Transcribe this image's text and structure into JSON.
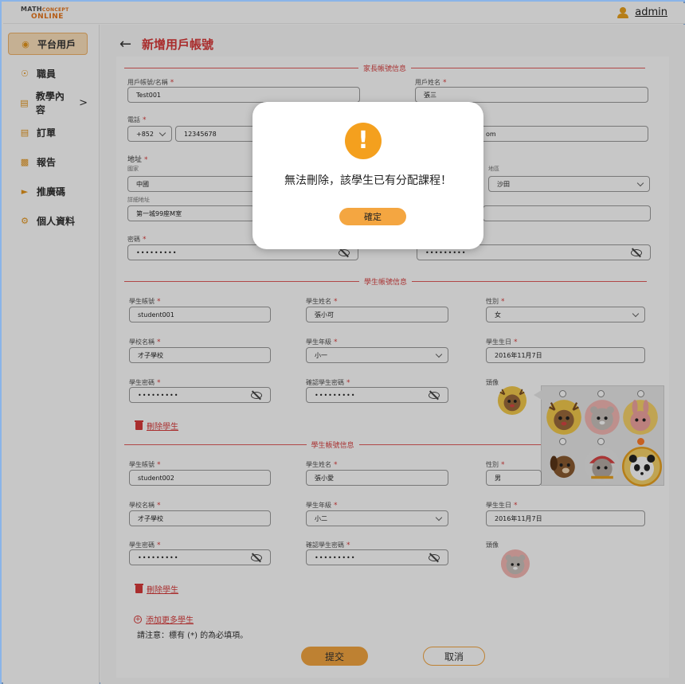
{
  "app": {
    "logo_line1": "MATH",
    "logo_line1b": "CONCEPT",
    "logo_line2": "ONLINE",
    "user": "admin"
  },
  "sidebar": {
    "items": [
      {
        "label": "平台用戶",
        "icon": "users-icon"
      },
      {
        "label": "職員",
        "icon": "staff-icon"
      },
      {
        "label": "教學內容",
        "icon": "book-icon",
        "chevron": ">"
      },
      {
        "label": "訂單",
        "icon": "order-icon"
      },
      {
        "label": "報告",
        "icon": "report-icon"
      },
      {
        "label": "推廣碼",
        "icon": "megaphone-icon"
      },
      {
        "label": "個人資料",
        "icon": "profile-icon"
      }
    ]
  },
  "page": {
    "back": "←",
    "title": "新增用戶帳號"
  },
  "parent": {
    "section_title": "家長帳號信息",
    "account_label": "用戶帳號/名稱",
    "account_value": "Test001",
    "name_label": "用戶姓名",
    "name_value": "張三",
    "phone_label": "電話",
    "phone_code": "+852",
    "phone_value": "12345678",
    "email_value": "om",
    "address_label": "地址",
    "country_label": "國家",
    "country_value": "中國",
    "district_label": "地區",
    "district_value": "沙田",
    "detail_label": "詳細地址",
    "detail_value": "第一城99座M室",
    "password_label": "密碼",
    "password_value": "•••••••••",
    "confirm_value": "•••••••••"
  },
  "students": [
    {
      "section_title": "學生帳號信息",
      "account_label": "學生帳號",
      "account_value": "student001",
      "name_label": "學生姓名",
      "name_value": "張小可",
      "gender_label": "性別",
      "gender_value": "女",
      "school_label": "學校名稱",
      "school_value": "才子學校",
      "grade_label": "學生年級",
      "grade_value": "小一",
      "birthday_label": "學生生日",
      "birthday_value": "2016年11月7日",
      "password_label": "學生密碼",
      "password_value": "•••••••••",
      "confirm_label": "確認學生密碼",
      "confirm_value": "•••••••••",
      "avatar_label": "頭像",
      "delete_label": "刪除學生"
    },
    {
      "section_title": "學生帳號信息",
      "account_label": "學生帳號",
      "account_value": "student002",
      "name_label": "學生姓名",
      "name_value": "張小愛",
      "gender_label": "性別",
      "gender_value": "男",
      "school_label": "學校名稱",
      "school_value": "才子學校",
      "grade_label": "學生年級",
      "grade_value": "小二",
      "birthday_label": "學生生日",
      "birthday_value": "2016年11月7日",
      "password_label": "學生密碼",
      "password_value": "•••••••••",
      "confirm_label": "確認學生密碼",
      "confirm_value": "•••••••••",
      "avatar_label": "頭像",
      "delete_label": "刪除學生"
    }
  ],
  "avatar_picker": {
    "options": [
      "reindeer",
      "hamster",
      "rabbit",
      "dog",
      "bear",
      "panda"
    ],
    "selected_index": 5
  },
  "footer": {
    "add_more": "添加更多學生",
    "note": "請注意：標有 (*) 的為必填項。",
    "submit": "提交",
    "cancel": "取消"
  },
  "dialog": {
    "icon": "!",
    "message": "無法刪除，該學生已有分配課程！",
    "confirm": "確定"
  },
  "required_mark": "*"
}
